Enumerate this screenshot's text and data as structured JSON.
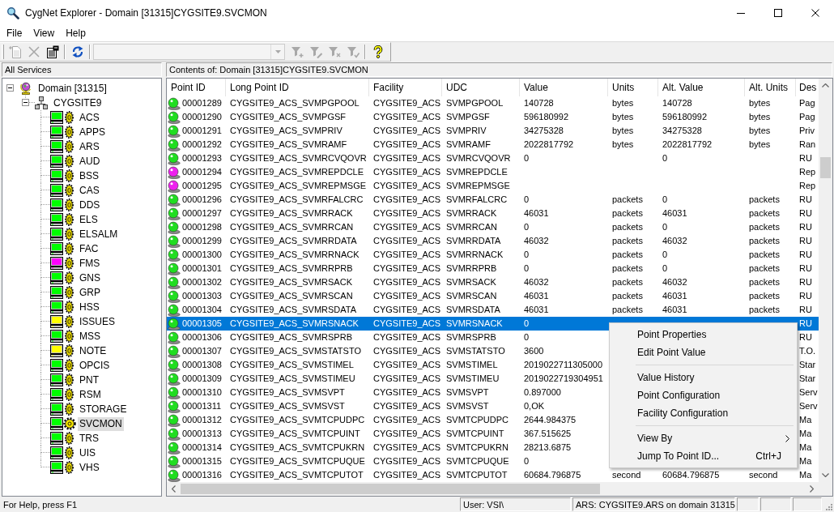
{
  "window": {
    "title": "CygNet Explorer - Domain [31315]CYGSITE9.SVCMON"
  },
  "menu": [
    "File",
    "View",
    "Help"
  ],
  "toolbar": {
    "buttons": [
      {
        "disabled": true
      },
      {
        "disabled": true
      },
      {
        "disabled": false
      },
      {
        "disabled": false
      }
    ],
    "filter_box": {
      "disabled": true
    },
    "filter_buttons": [
      {
        "disabled": true
      },
      {
        "disabled": true
      },
      {
        "disabled": true
      },
      {
        "disabled": true
      }
    ],
    "help_button": {
      "disabled": false
    }
  },
  "tree_pane": {
    "title": "All Services",
    "tree": [
      {
        "label": "Domain [31315]",
        "expanded": true,
        "selected": false,
        "children": [
          {
            "label": "CYGSITE9",
            "expanded": true,
            "selected": false,
            "children": [
              {
                "label": "ACS",
                "color": "#00ff00",
                "selected": false
              },
              {
                "label": "APPS",
                "color": "#00ff00",
                "selected": false
              },
              {
                "label": "ARS",
                "color": "#00ff00",
                "selected": false
              },
              {
                "label": "AUD",
                "color": "#00ff00",
                "selected": false
              },
              {
                "label": "BSS",
                "color": "#00ff00",
                "selected": false
              },
              {
                "label": "CAS",
                "color": "#00ff00",
                "selected": false
              },
              {
                "label": "DDS",
                "color": "#00ff00",
                "selected": false
              },
              {
                "label": "ELS",
                "color": "#00ff00",
                "selected": false
              },
              {
                "label": "ELSALM",
                "color": "#00ff00",
                "selected": false
              },
              {
                "label": "FAC",
                "color": "#00ff00",
                "selected": false
              },
              {
                "label": "FMS",
                "color": "#ff00ff",
                "selected": false
              },
              {
                "label": "GNS",
                "color": "#00ff00",
                "selected": false
              },
              {
                "label": "GRP",
                "color": "#00ff00",
                "selected": false
              },
              {
                "label": "HSS",
                "color": "#00ff00",
                "selected": false
              },
              {
                "label": "ISSUES",
                "color": "#ffff00",
                "selected": false
              },
              {
                "label": "MSS",
                "color": "#00ff00",
                "selected": false
              },
              {
                "label": "NOTE",
                "color": "#ffff00",
                "selected": false
              },
              {
                "label": "OPCIS",
                "color": "#00ff00",
                "selected": false
              },
              {
                "label": "PNT",
                "color": "#00ff00",
                "selected": false
              },
              {
                "label": "RSM",
                "color": "#00ff00",
                "selected": false
              },
              {
                "label": "STORAGE",
                "color": "#00ff00",
                "selected": false
              },
              {
                "label": "SVCMON",
                "color": "#00ff00",
                "selected": true
              },
              {
                "label": "TRS",
                "color": "#00ff00",
                "selected": false
              },
              {
                "label": "UIS",
                "color": "#00ff00",
                "selected": false
              },
              {
                "label": "VHS",
                "color": "#00ff00",
                "selected": false
              }
            ]
          }
        ]
      }
    ]
  },
  "content_pane": {
    "title": "Contents of: Domain [31315]CYGSITE9.SVCMON",
    "table": {
      "columns": [
        "Point ID",
        "Long Point ID",
        "Facility",
        "UDC",
        "Value",
        "Units",
        "Alt. Value",
        "Alt. Units",
        "Des"
      ],
      "rows": [
        {
          "point_id": "00001289",
          "long_point_id": "CYGSITE9_ACS_SVMPGPOOL",
          "facility": "CYGSITE9_ACS",
          "udc": "SVMPGPOOL",
          "value": "140728",
          "units": "bytes",
          "alt_value": "140728",
          "alt_units": "bytes",
          "description": "Pag",
          "color": "#20dd20",
          "selected": false
        },
        {
          "point_id": "00001290",
          "long_point_id": "CYGSITE9_ACS_SVMPGSF",
          "facility": "CYGSITE9_ACS",
          "udc": "SVMPGSF",
          "value": "596180992",
          "units": "bytes",
          "alt_value": "596180992",
          "alt_units": "bytes",
          "description": "Pag",
          "color": "#20dd20",
          "selected": false
        },
        {
          "point_id": "00001291",
          "long_point_id": "CYGSITE9_ACS_SVMPRIV",
          "facility": "CYGSITE9_ACS",
          "udc": "SVMPRIV",
          "value": "34275328",
          "units": "bytes",
          "alt_value": "34275328",
          "alt_units": "bytes",
          "description": "Priv",
          "color": "#20dd20",
          "selected": false
        },
        {
          "point_id": "00001292",
          "long_point_id": "CYGSITE9_ACS_SVMRAMF",
          "facility": "CYGSITE9_ACS",
          "udc": "SVMRAMF",
          "value": "2022817792",
          "units": "bytes",
          "alt_value": "2022817792",
          "alt_units": "bytes",
          "description": "Ran",
          "color": "#20dd20",
          "selected": false
        },
        {
          "point_id": "00001293",
          "long_point_id": "CYGSITE9_ACS_SVMRCVQOVR",
          "facility": "CYGSITE9_ACS",
          "udc": "SVMRCVQOVR",
          "value": "0",
          "alt_value": "0",
          "description": "RU",
          "color": "#20dd20",
          "selected": false
        },
        {
          "point_id": "00001294",
          "long_point_id": "CYGSITE9_ACS_SVMREPDCLE",
          "facility": "CYGSITE9_ACS",
          "udc": "SVMREPDCLE",
          "description": "Rep",
          "color": "#ee20ee",
          "selected": false
        },
        {
          "point_id": "00001295",
          "long_point_id": "CYGSITE9_ACS_SVMREPMSGE",
          "facility": "CYGSITE9_ACS",
          "udc": "SVMREPMSGE",
          "description": "Rep",
          "color": "#ee20ee",
          "selected": false
        },
        {
          "point_id": "00001296",
          "long_point_id": "CYGSITE9_ACS_SVMRFALCRC",
          "facility": "CYGSITE9_ACS",
          "udc": "SVMRFALCRC",
          "value": "0",
          "units": "packets",
          "alt_value": "0",
          "alt_units": "packets",
          "description": "RU",
          "color": "#20dd20",
          "selected": false
        },
        {
          "point_id": "00001297",
          "long_point_id": "CYGSITE9_ACS_SVMRRACK",
          "facility": "CYGSITE9_ACS",
          "udc": "SVMRRACK",
          "value": "46031",
          "units": "packets",
          "alt_value": "46031",
          "alt_units": "packets",
          "description": "RU",
          "color": "#20dd20",
          "selected": false
        },
        {
          "point_id": "00001298",
          "long_point_id": "CYGSITE9_ACS_SVMRRCAN",
          "facility": "CYGSITE9_ACS",
          "udc": "SVMRRCAN",
          "value": "0",
          "units": "packets",
          "alt_value": "0",
          "alt_units": "packets",
          "description": "RU",
          "color": "#20dd20",
          "selected": false
        },
        {
          "point_id": "00001299",
          "long_point_id": "CYGSITE9_ACS_SVMRRDATA",
          "facility": "CYGSITE9_ACS",
          "udc": "SVMRRDATA",
          "value": "46032",
          "units": "packets",
          "alt_value": "46032",
          "alt_units": "packets",
          "description": "RU",
          "color": "#20dd20",
          "selected": false
        },
        {
          "point_id": "00001300",
          "long_point_id": "CYGSITE9_ACS_SVMRRNACK",
          "facility": "CYGSITE9_ACS",
          "udc": "SVMRRNACK",
          "value": "0",
          "units": "packets",
          "alt_value": "0",
          "alt_units": "packets",
          "description": "RU",
          "color": "#20dd20",
          "selected": false
        },
        {
          "point_id": "00001301",
          "long_point_id": "CYGSITE9_ACS_SVMRRPRB",
          "facility": "CYGSITE9_ACS",
          "udc": "SVMRRPRB",
          "value": "0",
          "units": "packets",
          "alt_value": "0",
          "alt_units": "packets",
          "description": "RU",
          "color": "#20dd20",
          "selected": false
        },
        {
          "point_id": "00001302",
          "long_point_id": "CYGSITE9_ACS_SVMRSACK",
          "facility": "CYGSITE9_ACS",
          "udc": "SVMRSACK",
          "value": "46032",
          "units": "packets",
          "alt_value": "46032",
          "alt_units": "packets",
          "description": "RU",
          "color": "#20dd20",
          "selected": false
        },
        {
          "point_id": "00001303",
          "long_point_id": "CYGSITE9_ACS_SVMRSCAN",
          "facility": "CYGSITE9_ACS",
          "udc": "SVMRSCAN",
          "value": "46031",
          "units": "packets",
          "alt_value": "46031",
          "alt_units": "packets",
          "description": "RU",
          "color": "#20dd20",
          "selected": false
        },
        {
          "point_id": "00001304",
          "long_point_id": "CYGSITE9_ACS_SVMRSDATA",
          "facility": "CYGSITE9_ACS",
          "udc": "SVMRSDATA",
          "value": "46031",
          "units": "packets",
          "alt_value": "46031",
          "alt_units": "packets",
          "description": "RU",
          "color": "#20dd20",
          "selected": false
        },
        {
          "point_id": "00001305",
          "long_point_id": "CYGSITE9_ACS_SVMRSNACK",
          "facility": "CYGSITE9_ACS",
          "udc": "SVMRSNACK",
          "value": "0",
          "description": "RU",
          "color": "#20dd20",
          "selected": true
        },
        {
          "point_id": "00001306",
          "long_point_id": "CYGSITE9_ACS_SVMRSPRB",
          "facility": "CYGSITE9_ACS",
          "udc": "SVMRSPRB",
          "value": "0",
          "description": "RU",
          "color": "#20dd20",
          "selected": false
        },
        {
          "point_id": "00001307",
          "long_point_id": "CYGSITE9_ACS_SVMSTATSTO",
          "facility": "CYGSITE9_ACS",
          "udc": "SVMSTATSTO",
          "value": "3600",
          "description": "T.O.",
          "color": "#20dd20",
          "selected": false
        },
        {
          "point_id": "00001308",
          "long_point_id": "CYGSITE9_ACS_SVMSTIMEL",
          "facility": "CYGSITE9_ACS",
          "udc": "SVMSTIMEL",
          "value": "2019022711305000",
          "description": "Star",
          "color": "#20dd20",
          "selected": false
        },
        {
          "point_id": "00001309",
          "long_point_id": "CYGSITE9_ACS_SVMSTIMEU",
          "facility": "CYGSITE9_ACS",
          "udc": "SVMSTIMEU",
          "value": "2019022719304951",
          "description": "Star",
          "color": "#20dd20",
          "selected": false
        },
        {
          "point_id": "00001310",
          "long_point_id": "CYGSITE9_ACS_SVMSVPT",
          "facility": "CYGSITE9_ACS",
          "udc": "SVMSVPT",
          "value": "0.897000",
          "description": "Serv",
          "color": "#20dd20",
          "selected": false
        },
        {
          "point_id": "00001311",
          "long_point_id": "CYGSITE9_ACS_SVMSVST",
          "facility": "CYGSITE9_ACS",
          "udc": "SVMSVST",
          "value": "0,OK",
          "description": "Serv",
          "color": "#20dd20",
          "selected": false
        },
        {
          "point_id": "00001312",
          "long_point_id": "CYGSITE9_ACS_SVMTCPUDPC",
          "facility": "CYGSITE9_ACS",
          "udc": "SVMTCPUDPC",
          "value": "2644.984375",
          "description": "Ma",
          "color": "#20dd20",
          "selected": false
        },
        {
          "point_id": "00001313",
          "long_point_id": "CYGSITE9_ACS_SVMTCPUINT",
          "facility": "CYGSITE9_ACS",
          "udc": "SVMTCPUINT",
          "value": "367.515625",
          "description": "Ma",
          "color": "#20dd20",
          "selected": false
        },
        {
          "point_id": "00001314",
          "long_point_id": "CYGSITE9_ACS_SVMTCPUKRN",
          "facility": "CYGSITE9_ACS",
          "udc": "SVMTCPUKRN",
          "value": "28213.6875",
          "description": "Ma",
          "color": "#20dd20",
          "selected": false
        },
        {
          "point_id": "00001315",
          "long_point_id": "CYGSITE9_ACS_SVMTCPUQUE",
          "facility": "CYGSITE9_ACS",
          "udc": "SVMTCPUQUE",
          "value": "0",
          "description": "Ma",
          "color": "#20dd20",
          "selected": false
        },
        {
          "point_id": "00001316",
          "long_point_id": "CYGSITE9_ACS_SVMTCPUTOT",
          "facility": "CYGSITE9_ACS",
          "udc": "SVMTCPUTOT",
          "value": "60684.796875",
          "units": "second",
          "alt_value": "60684.796875",
          "alt_units": "second",
          "description": "Ma",
          "color": "#20dd20",
          "selected": false
        }
      ]
    }
  },
  "context_menu": {
    "items": [
      {
        "kind": "item",
        "label": "Point Properties"
      },
      {
        "kind": "item",
        "label": "Edit Point Value"
      },
      {
        "kind": "separator"
      },
      {
        "kind": "item",
        "label": "Value History"
      },
      {
        "kind": "item",
        "label": "Point Configuration"
      },
      {
        "kind": "item",
        "label": "Facility Configuration"
      },
      {
        "kind": "separator"
      },
      {
        "kind": "submenu",
        "label": "View By"
      },
      {
        "kind": "item",
        "label": "Jump To Point ID...",
        "shortcut": "Ctrl+J"
      }
    ]
  },
  "status_bar": {
    "message": "For Help, press F1",
    "panes": [
      "User: VSI\\",
      "ARS: CYGSITE9.ARS on domain 31315"
    ]
  }
}
